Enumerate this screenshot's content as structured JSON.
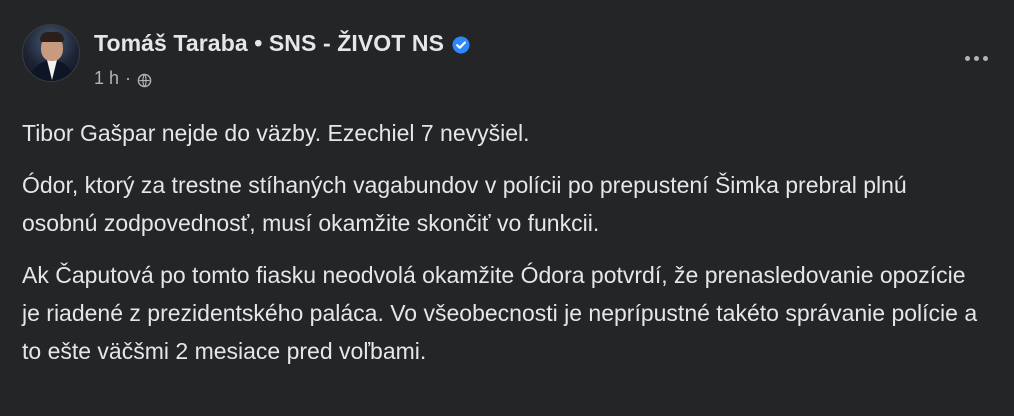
{
  "post": {
    "author": "Tomáš Taraba • SNS - ŽIVOT NS",
    "time": "1 h",
    "separator": "·",
    "paragraphs": [
      "Tibor Gašpar nejde do väzby. Ezechiel 7 nevyšiel.",
      "Ódor, ktorý za trestne stíhaných vagabundov v polícii po prepustení Šimka prebral plnú osobnú zodpovednosť, musí okamžite skončiť vo funkcii.",
      "Ak Čaputová po tomto fiasku neodvolá okamžite Ódora potvrdí, že prenasledovanie opozície je riadené z prezidentského paláca. Vo všeobecnosti je neprípustné takéto správanie polície a to ešte väčšmi 2 mesiace pred voľbami."
    ],
    "icons": {
      "verified": "verified-badge-icon",
      "audience": "globe-icon",
      "more": "more-options-icon"
    }
  },
  "colors": {
    "background": "#242526",
    "text": "#e4e6eb",
    "secondary_text": "#b0b3b8",
    "verified": "#2d88ff"
  }
}
